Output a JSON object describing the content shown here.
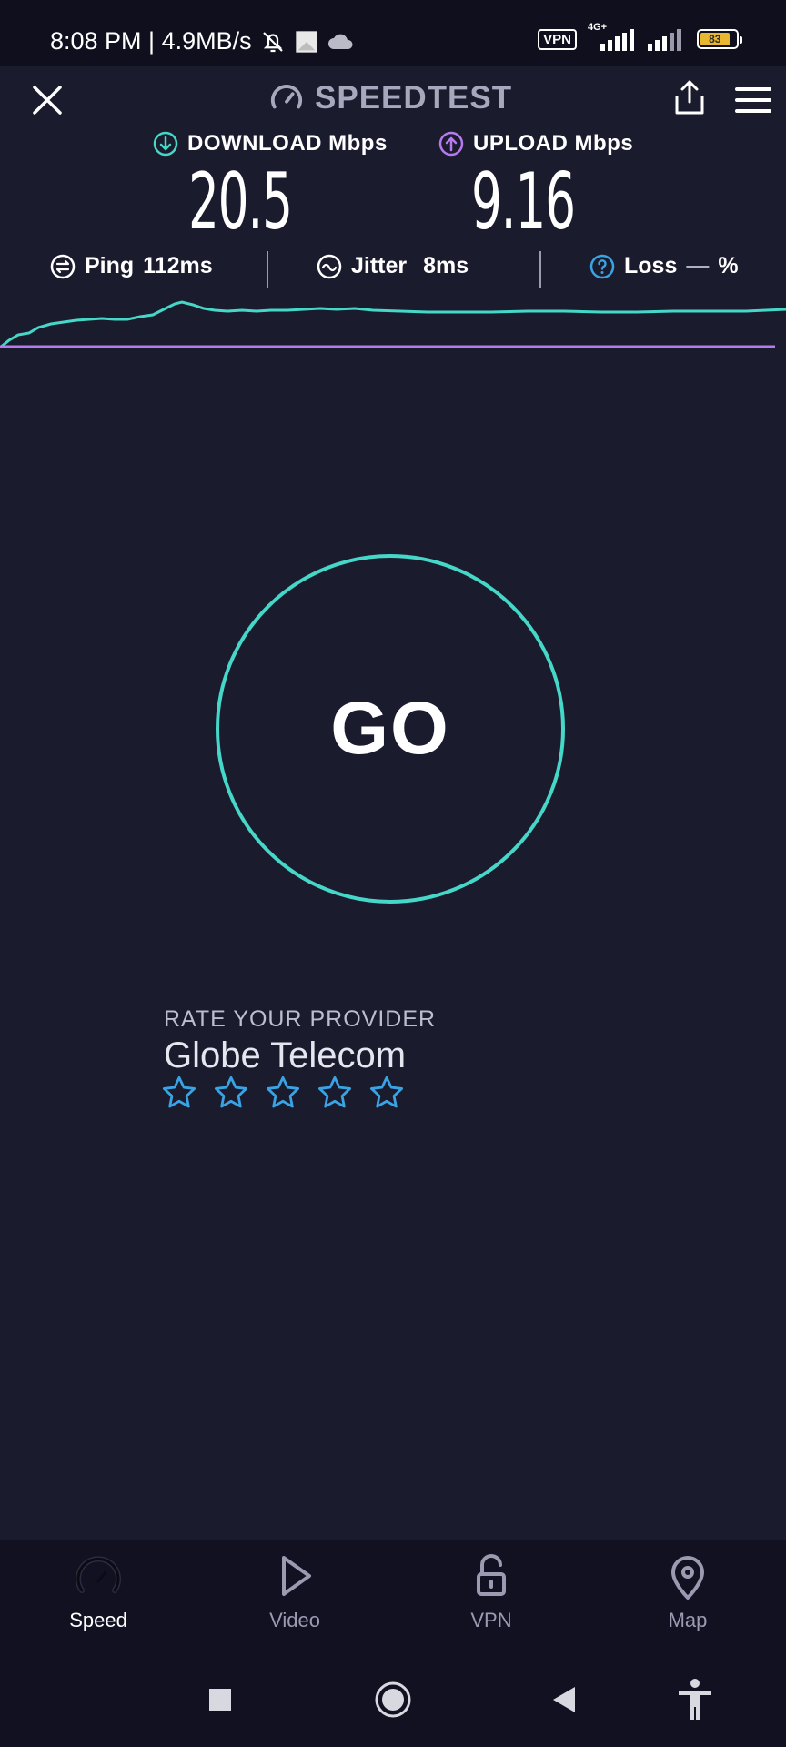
{
  "status_bar": {
    "time_speed": "8:08 PM | 4.9MB/s",
    "vpn": "VPN",
    "network": "4G+",
    "battery": "83",
    "battery_level": 0.83
  },
  "header": {
    "brand": "SPEEDTEST"
  },
  "metrics": {
    "download_label": "DOWNLOAD Mbps",
    "download_value": "20.5",
    "upload_label": "UPLOAD Mbps",
    "upload_value": "9.16",
    "ping_label": "Ping",
    "ping_value": "112ms",
    "jitter_label": "Jitter",
    "jitter_value": "8ms",
    "loss_label": "Loss",
    "loss_value": "—",
    "loss_unit": "%"
  },
  "go_button": {
    "label": "GO"
  },
  "rating": {
    "title": "RATE YOUR PROVIDER",
    "provider": "Globe Telecom",
    "stars_filled": 0,
    "stars_total": 5
  },
  "bottom_nav": [
    {
      "label": "Speed",
      "icon": "speedometer-icon",
      "active": true
    },
    {
      "label": "Video",
      "icon": "play-icon",
      "active": false
    },
    {
      "label": "VPN",
      "icon": "lock-icon",
      "active": false
    },
    {
      "label": "Map",
      "icon": "map-pin-icon",
      "active": false
    }
  ],
  "colors": {
    "background": "#1b1b2e",
    "accent_download": "#45d7c7",
    "accent_upload": "#b57bee",
    "star": "#3aa3e3"
  }
}
